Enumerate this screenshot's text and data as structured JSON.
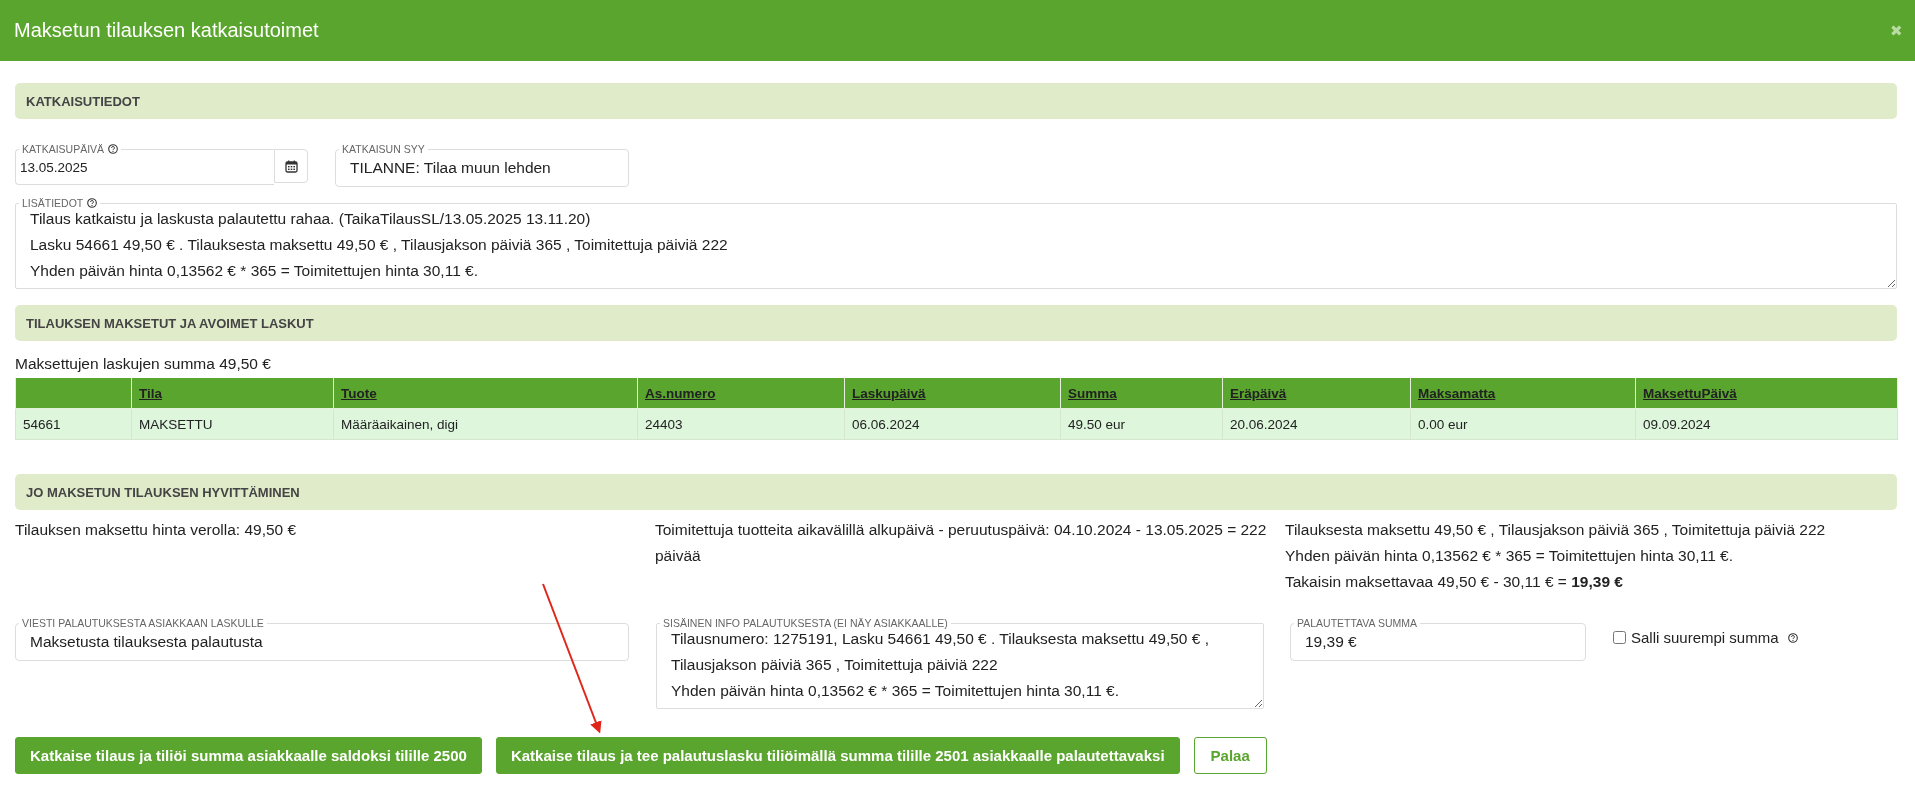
{
  "dialog": {
    "title": "Maksetun tilauksen katkaisutoimet",
    "close_icon": "✖"
  },
  "cancellation": {
    "title": "KATKAISUTIEDOT",
    "date_field": {
      "label": "KATKAISUPÄIVÄ",
      "value": "13.05.2025"
    },
    "reason_field": {
      "label": "KATKAISUN SYY",
      "value": "TILANNE: Tilaa muun lehden"
    },
    "notes_field": {
      "label": "LISÄTIEDOT",
      "lines": [
        "Tilaus katkaistu ja laskusta palautettu rahaa. (TaikaTilausSL/13.05.2025 13.11.20)",
        "Lasku 54661 49,50 € . Tilauksesta maksettu 49,50 € , Tilausjakson päiviä 365 , Toimitettuja päiviä 222",
        "Yhden päivän hinta 0,13562 € * 365 = Toimitettujen hinta 30,11 €."
      ]
    }
  },
  "invoices": {
    "title": "TILAUKSEN MAKSETUT JA AVOIMET LASKUT",
    "summary": "Maksettujen laskujen summa 49,50 €",
    "columns": [
      "Tila",
      "Tuote",
      "As.numero",
      "Laskupäivä",
      "Summa",
      "Eräpäivä",
      "Maksamatta",
      "MaksettuPäivä"
    ],
    "rows": [
      {
        "column_1": "54661",
        "cells": [
          "MAKSETTU",
          "Määräaikainen, digi",
          "24403",
          "06.06.2024",
          "49.50 eur",
          "20.06.2024",
          "0.00 eur",
          "09.09.2024"
        ]
      }
    ]
  },
  "refund": {
    "title": "JO MAKSETUN TILAUKSEN HYVITTÄMINEN",
    "paid_price": "Tilauksen maksettu hinta verolla: 49,50 €",
    "delivered_period": "Toimitettuja tuotteita aikavälillä alkupäivä - peruutuspäivä: 04.10.2024 - 13.05.2025 = 222 päivää",
    "calculation": [
      "Tilauksesta maksettu 49,50 € , Tilausjakson päiviä 365 , Toimitettuja päiviä 222",
      "Yhden päivän hinta 0,13562 € * 365 = Toimitettujen hinta 30,11 €.",
      "Takaisin maksettavaa 49,50 € - 30,11 € = **19,39 €**"
    ],
    "message_field": {
      "label": "VIESTI PALAUTUKSESTA ASIAKKAAN LASKULLE",
      "value": "Maksetusta tilauksesta palautusta"
    },
    "internal_field": {
      "label": "SISÄINEN INFO PALAUTUKSESTA (EI NÄY ASIAKKAALLE)",
      "lines": [
        "Tilausnumero: 1275191, Lasku 54661 49,50 € . Tilauksesta maksettu 49,50 € , Tilausjakson päiviä 365 , Toimitettuja päiviä 222",
        "Yhden päivän hinta 0,13562 € * 365 = Toimitettujen hinta 30,11 €."
      ]
    },
    "amount_field": {
      "label": "PALAUTETTAVA SUMMA",
      "value": "19,39 €"
    },
    "allow_larger": {
      "label": "Salli suurempi summa",
      "checked": false
    }
  },
  "buttons": [
    {
      "label": "Katkaise tilaus ja tiliöi summa asiakkaalle saldoksi tilille 2500",
      "kind": "primary"
    },
    {
      "label": "Katkaise tilaus ja tee palautuslasku tiliöimällä summa tilille 2501 asiakkaalle palautettavaksi",
      "kind": "primary"
    },
    {
      "label": "Palaa",
      "kind": "outline"
    }
  ]
}
